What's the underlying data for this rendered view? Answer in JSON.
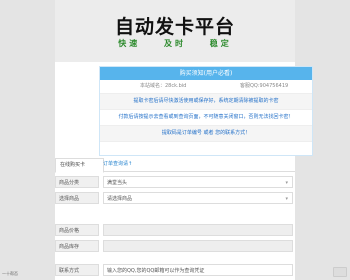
{
  "header": {
    "title": "自动发卡平台",
    "slogans": [
      "快速",
      "及时",
      "稳定"
    ]
  },
  "panel": {
    "heading": "购买须知(用户必看)",
    "shop_domain": "本站域名：28ck.bid",
    "service_qq": "客服QQ:904756419",
    "notices": [
      "提取卡密后请尽快激活使用或保存好，系统定期清除被提取的卡密",
      "付款后请按提示去查看或到查询页面，不可随意关闭窗口，否则无法找回卡密！",
      "提取码是订单编号 或者 您的联系方式！"
    ]
  },
  "tabs": {
    "active": "在线购买卡",
    "link": "订单查询请↑"
  },
  "form": {
    "rows": [
      {
        "label": "商品分类",
        "value": "满堂当头",
        "caret": "▾"
      },
      {
        "label": "选择商品",
        "value": "请选择商品",
        "caret": "▾"
      },
      {
        "label": "商品价格",
        "value": ""
      },
      {
        "label": "商品库存",
        "value": ""
      },
      {
        "label": "联系方式",
        "value": "输入您的QQ,您的QQ邮箱可以作为查询凭证"
      }
    ]
  },
  "sidebar": {
    "left_text": "一十帮否"
  }
}
